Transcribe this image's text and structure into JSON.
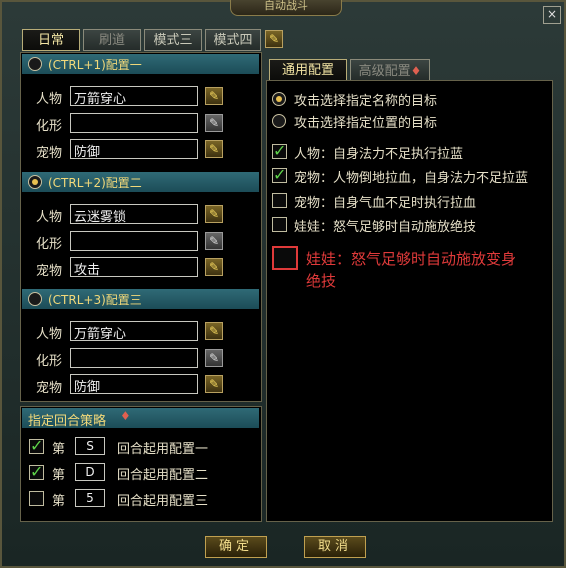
{
  "window": {
    "title": "自动战斗",
    "close_label": "×"
  },
  "tabs": [
    {
      "label": "日常",
      "active": true
    },
    {
      "label": "刷道",
      "active": false
    },
    {
      "label": "模式三",
      "active": false
    },
    {
      "label": "模式四",
      "active": false
    }
  ],
  "configs": [
    {
      "header": "(CTRL+1)配置一",
      "selected": false,
      "rows": [
        {
          "label": "人物",
          "value": "万箭穿心",
          "editable": true
        },
        {
          "label": "化形",
          "value": "",
          "editable": false
        },
        {
          "label": "宠物",
          "value": "防御",
          "editable": true
        }
      ]
    },
    {
      "header": "(CTRL+2)配置二",
      "selected": true,
      "rows": [
        {
          "label": "人物",
          "value": "云迷雾锁",
          "editable": true
        },
        {
          "label": "化形",
          "value": "",
          "editable": false
        },
        {
          "label": "宠物",
          "value": "攻击",
          "editable": true
        }
      ]
    },
    {
      "header": "(CTRL+3)配置三",
      "selected": false,
      "rows": [
        {
          "label": "人物",
          "value": "万箭穿心",
          "editable": true
        },
        {
          "label": "化形",
          "value": "",
          "editable": false
        },
        {
          "label": "宠物",
          "value": "防御",
          "editable": true
        }
      ]
    }
  ],
  "strategy": {
    "header": "指定回合策略",
    "prefix": "第",
    "rows": [
      {
        "checked": true,
        "value": "S",
        "suffix": "回合起用配置一"
      },
      {
        "checked": true,
        "value": "D",
        "suffix": "回合起用配置二"
      },
      {
        "checked": false,
        "value": "5",
        "suffix": "回合起用配置三"
      }
    ]
  },
  "right_tabs": [
    {
      "label": "通用配置",
      "active": true
    },
    {
      "label": "高级配置",
      "active": false
    }
  ],
  "target_options": [
    {
      "label": "攻击选择指定名称的目标",
      "selected": true
    },
    {
      "label": "攻击选择指定位置的目标",
      "selected": false
    }
  ],
  "check_options": [
    {
      "label": "人物：自身法力不足执行拉蓝",
      "checked": true
    },
    {
      "label": "宠物：人物倒地拉血，自身法力不足拉蓝",
      "checked": true
    },
    {
      "label": "宠物：自身气血不足时执行拉血",
      "checked": false
    },
    {
      "label": "娃娃：怒气足够时自动施放绝技",
      "checked": false
    }
  ],
  "highlight_option": {
    "label_line1": "娃娃：怒气足够时自动施放变身",
    "label_line2": "绝技",
    "color": "#e03a3a"
  },
  "buttons": {
    "confirm": "确定",
    "cancel": "取消"
  },
  "colors": {
    "accent_gold": "#f2d97a",
    "check_green": "#5fd34a",
    "header_teal": "#2f6a76"
  }
}
